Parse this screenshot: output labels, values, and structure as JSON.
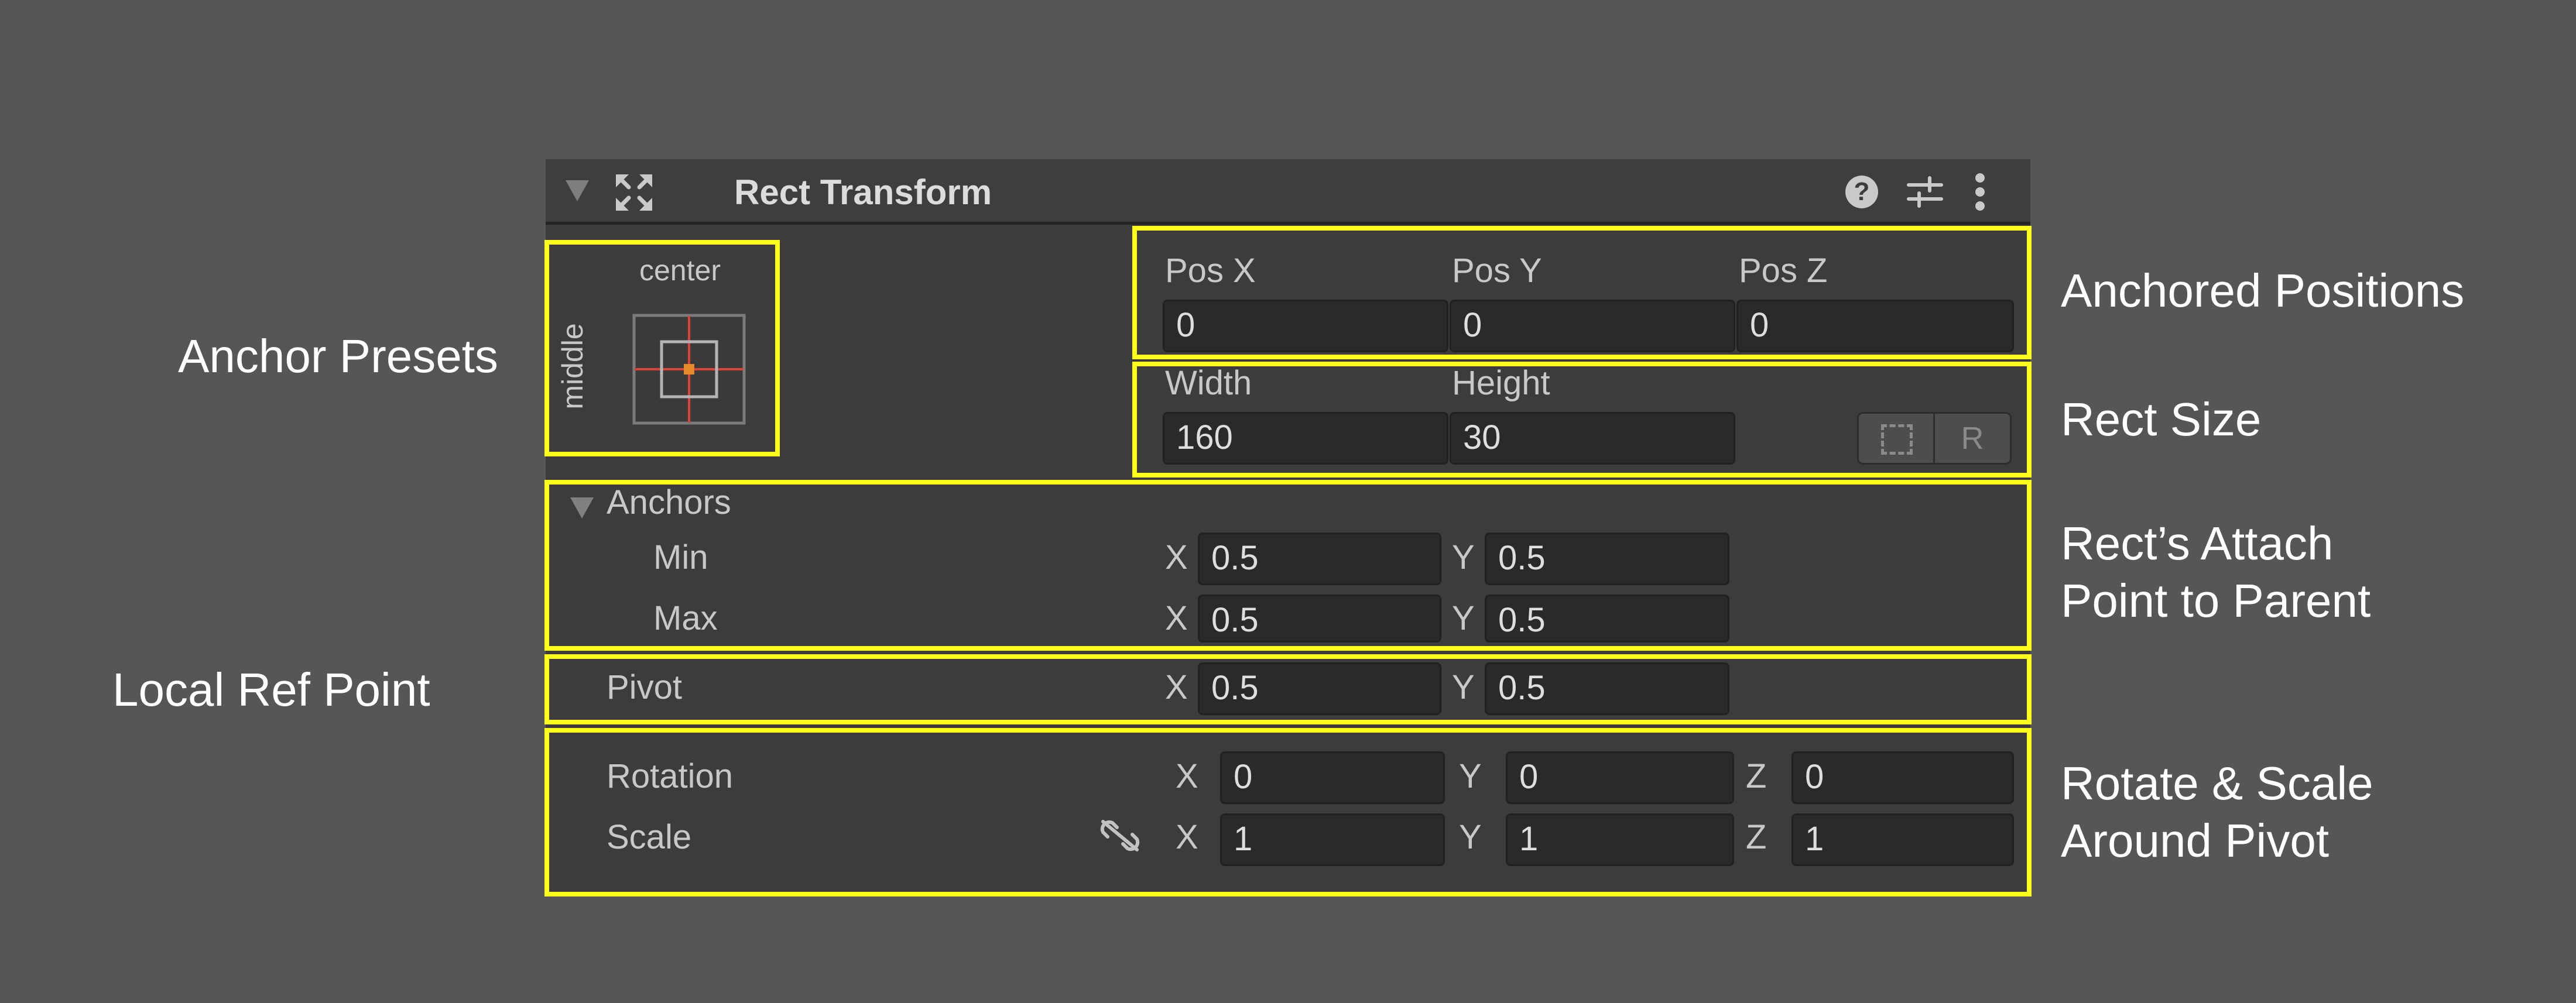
{
  "component": {
    "title": "Rect Transform",
    "icons": [
      "collapse-triangle",
      "rect-tool-icon",
      "help-icon",
      "presets-icon",
      "kebab-menu-icon"
    ]
  },
  "anchor_preset": {
    "horizontal_label": "center",
    "vertical_label": "middle"
  },
  "position": {
    "pos_x_label": "Pos X",
    "pos_x": "0",
    "pos_y_label": "Pos Y",
    "pos_y": "0",
    "pos_z_label": "Pos Z",
    "pos_z": "0"
  },
  "size": {
    "width_label": "Width",
    "width": "160",
    "height_label": "Height",
    "height": "30",
    "raw_edit_label": "R"
  },
  "anchors": {
    "label": "Anchors",
    "min_label": "Min",
    "min_x": "0.5",
    "min_y": "0.5",
    "max_label": "Max",
    "max_x": "0.5",
    "max_y": "0.5"
  },
  "pivot": {
    "label": "Pivot",
    "x": "0.5",
    "y": "0.5"
  },
  "rotation": {
    "label": "Rotation",
    "x": "0",
    "y": "0",
    "z": "0"
  },
  "scale": {
    "label": "Scale",
    "x": "1",
    "y": "1",
    "z": "1"
  },
  "axes": {
    "x": "X",
    "y": "Y",
    "z": "Z"
  },
  "annotations": {
    "anchor_presets": "Anchor Presets",
    "local_ref_point": "Local Ref Point",
    "anchored_positions": "Anchored Positions",
    "rect_size": "Rect Size",
    "attach_line1": "Rect’s Attach",
    "attach_line2": "Point to Parent",
    "rotate_line1": "Rotate & Scale",
    "rotate_line2": "Around Pivot"
  },
  "colors": {
    "background": "#565656",
    "panel": "#3c3c3c",
    "field": "#2a2a2a",
    "highlight": "#ffff1e",
    "anchor_line": "#d9443a",
    "anchor_dot": "#e8892a"
  }
}
